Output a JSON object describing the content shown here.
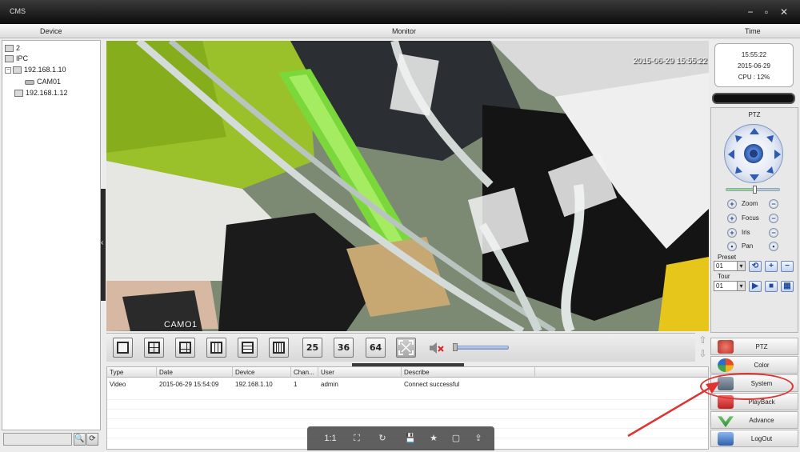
{
  "window": {
    "title": "CMS",
    "controls": [
      "−",
      "▫",
      "✕"
    ]
  },
  "header": {
    "device": "Device",
    "monitor": "Monitor",
    "time": "Time"
  },
  "tree": {
    "items": [
      {
        "label": "2",
        "type": "group"
      },
      {
        "label": "IPC",
        "type": "group"
      },
      {
        "label": "192.168.1.10",
        "type": "device",
        "expander": "−"
      },
      {
        "label": "CAM01",
        "type": "camera"
      },
      {
        "label": "192.168.1.12",
        "type": "device"
      }
    ]
  },
  "search": {
    "placeholder": "",
    "search_icon": "🔍",
    "refresh_icon": "⟳"
  },
  "video": {
    "timestamp": "2015-06-29 15:55:22",
    "camera_label": "CAMO1"
  },
  "layouts": {
    "counts": [
      "25",
      "36",
      "64"
    ]
  },
  "log": {
    "columns": [
      "Type",
      "Date",
      "Device",
      "Chan...",
      "User",
      "Describe"
    ],
    "rows": [
      [
        "Video",
        "2015-06-29 15:54:09",
        "192.168.1.10",
        "1",
        "admin",
        "Connect successful"
      ]
    ]
  },
  "floatbar": {
    "labels": [
      "1:1",
      "⛶",
      "↻",
      "💾",
      "★",
      "▢",
      "⇪"
    ]
  },
  "clock": {
    "time": "15:55:22",
    "date": "2015-06-29",
    "cpu": "CPU : 12%"
  },
  "ptz": {
    "title": "PTZ",
    "speed_level": 0.5,
    "controls": [
      "Zoom",
      "Focus",
      "Iris",
      "Pan"
    ],
    "preset_label": "Preset",
    "preset_value": "01",
    "tour_label": "Tour",
    "tour_value": "01"
  },
  "menu": {
    "items": [
      {
        "label": "PTZ",
        "icon": "ptz-icon",
        "color": "#c0392b"
      },
      {
        "label": "Color",
        "icon": "color-icon",
        "color": "#e9731a"
      },
      {
        "label": "System",
        "icon": "system-icon",
        "color": "#6b7b8c"
      },
      {
        "label": "PlayBack",
        "icon": "playback-icon",
        "color": "#d22c2c"
      },
      {
        "label": "Advance",
        "icon": "advance-icon",
        "color": "#3c9a3c"
      },
      {
        "label": "LogOut",
        "icon": "logout-icon",
        "color": "#3d6fb2"
      }
    ]
  },
  "colors": {
    "accent": "#2d5cb4",
    "annotation": "#e03232"
  }
}
